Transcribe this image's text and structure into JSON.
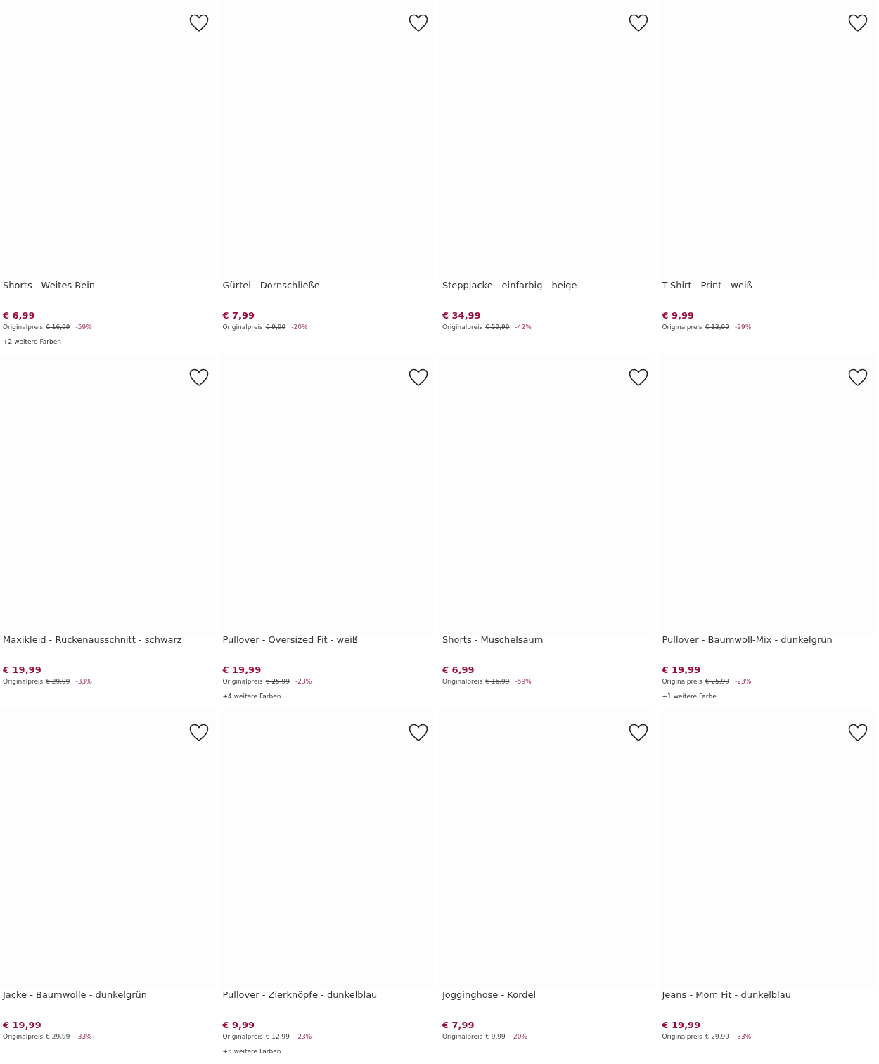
{
  "products": [
    {
      "title": "Shorts - Weites Bein",
      "price": "€ 6,99",
      "original_label": "Originalpreis",
      "original_price": "€ 16,99",
      "discount": "-59%",
      "colors": "+2 weitere Farben"
    },
    {
      "title": "Gürtel - Dornschließe",
      "price": "€ 7,99",
      "original_label": "Originalpreis",
      "original_price": "€ 9,99",
      "discount": "-20%"
    },
    {
      "title": "Steppjacke - einfarbig - beige",
      "price": "€ 34,99",
      "original_label": "Originalpreis",
      "original_price": "€ 59,99",
      "discount": "-42%"
    },
    {
      "title": "T-Shirt - Print - weiß",
      "price": "€ 9,99",
      "original_label": "Originalpreis",
      "original_price": "€ 13,99",
      "discount": "-29%"
    },
    {
      "title": "Maxikleid - Rückenausschnitt - schwarz",
      "price": "€ 19,99",
      "original_label": "Originalpreis",
      "original_price": "€ 29,99",
      "discount": "-33%"
    },
    {
      "title": "Pullover - Oversized Fit - weiß",
      "price": "€ 19,99",
      "original_label": "Originalpreis",
      "original_price": "€ 25,99",
      "discount": "-23%",
      "colors": "+4 weitere Farben"
    },
    {
      "title": "Shorts - Muschelsaum",
      "price": "€ 6,99",
      "original_label": "Originalpreis",
      "original_price": "€ 16,99",
      "discount": "-59%"
    },
    {
      "title": "Pullover - Baumwoll-Mix - dunkelgrün",
      "price": "€ 19,99",
      "original_label": "Originalpreis",
      "original_price": "€ 25,99",
      "discount": "-23%",
      "colors": "+1 weitere Farbe"
    },
    {
      "title": "Jacke - Baumwolle - dunkelgrün",
      "price": "€ 19,99",
      "original_label": "Originalpreis",
      "original_price": "€ 29,99",
      "discount": "-33%"
    },
    {
      "title": "Pullover - Zierknöpfe - dunkelblau",
      "price": "€ 9,99",
      "original_label": "Originalpreis",
      "original_price": "€ 12,99",
      "discount": "-23%",
      "colors": "+5 weitere Farben"
    },
    {
      "title": "Jogginghose - Kordel",
      "price": "€ 7,99",
      "original_label": "Originalpreis",
      "original_price": "€ 9,99",
      "discount": "-20%"
    },
    {
      "title": "Jeans - Mom Fit - dunkelblau",
      "price": "€ 19,99",
      "original_label": "Originalpreis",
      "original_price": "€ 29,99",
      "discount": "-33%"
    }
  ]
}
